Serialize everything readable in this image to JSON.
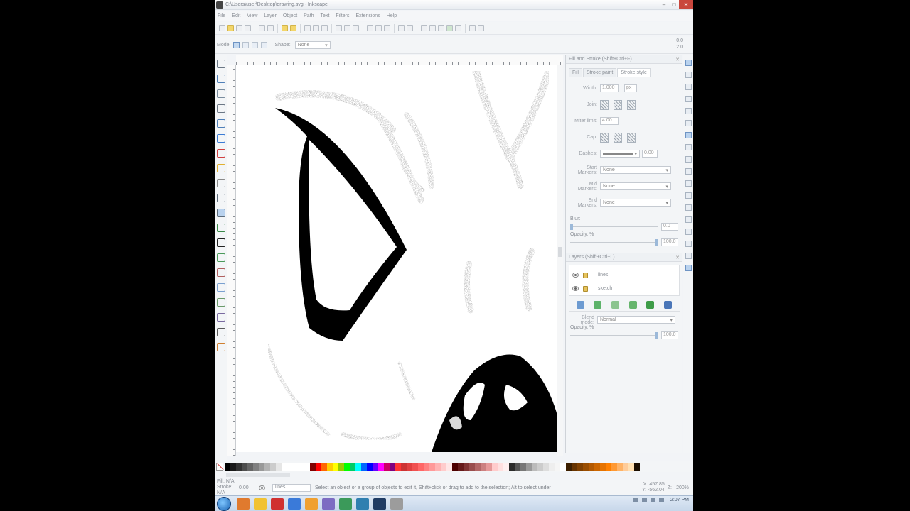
{
  "window": {
    "title": "C:\\Users\\user\\Desktop\\drawing.svg - Inkscape",
    "controls": [
      "minimize",
      "maximize",
      "close"
    ]
  },
  "menu": [
    "File",
    "Edit",
    "View",
    "Layer",
    "Object",
    "Path",
    "Text",
    "Filters",
    "Extensions",
    "Help"
  ],
  "tool_controls": {
    "mode_label": "Mode:",
    "shape_label": "Shape:",
    "shape_value": "None",
    "readout_top": "0.0",
    "readout_bottom": "2.0"
  },
  "fill_stroke": {
    "title": "Fill and Stroke (Shift+Ctrl+F)",
    "tabs": [
      "Fill",
      "Stroke paint",
      "Stroke style"
    ],
    "active_tab": 2,
    "width_label": "Width:",
    "width_value": "1.000",
    "unit_value": "px",
    "join_label": "Join:",
    "miter_label": "Miter limit:",
    "miter_value": "4.00",
    "cap_label": "Cap:",
    "dashes_label": "Dashes:",
    "dash_value": "0.00",
    "start_marker_label": "Start Markers:",
    "mid_marker_label": "Mid Markers:",
    "end_marker_label": "End Markers:",
    "marker_value": "None",
    "blur_label": "Blur:",
    "blur_value": "0.0",
    "opacity_label": "Opacity, %",
    "opacity_value": "100.0"
  },
  "layers_panel": {
    "title": "Layers (Shift+Ctrl+L)",
    "items": [
      {
        "name": "lines"
      },
      {
        "name": "sketch"
      }
    ],
    "blend_label": "Blend mode:",
    "blend_value": "Normal",
    "opacity_label": "Opacity, %",
    "opacity_value": "100.0"
  },
  "palette": {
    "swatches": [
      "#000000",
      "#1a1a1a",
      "#333333",
      "#4d4d4d",
      "#666666",
      "#808080",
      "#999999",
      "#b3b3b3",
      "#cccccc",
      "#e6e6e6",
      "#ffffff",
      "#ffffff",
      "#ffffff",
      "#ffffff",
      "#ffffff",
      "#800000",
      "#ff0000",
      "#ff6600",
      "#ffcc00",
      "#ffff00",
      "#99cc00",
      "#00ff00",
      "#00cc66",
      "#00ffff",
      "#0066ff",
      "#0000ff",
      "#6600ff",
      "#ff00ff",
      "#cc0066",
      "#800080",
      "#ff3333",
      "#cc3333",
      "#e04040",
      "#f05050",
      "#ff6666",
      "#ff8080",
      "#ff9999",
      "#ffb3b3",
      "#ffcccc",
      "#ffe6e6",
      "#4d0000",
      "#661a1a",
      "#803333",
      "#994d4d",
      "#b36666",
      "#cc8080",
      "#e69999",
      "#ffcccc",
      "#ffe0e0",
      "#fff0f0",
      "#2b2b2b",
      "#555555",
      "#777777",
      "#999999",
      "#bbbbbb",
      "#cccccc",
      "#dddddd",
      "#eeeeee",
      "#f5f5f5",
      "#ffffff",
      "#3d1f00",
      "#663300",
      "#804000",
      "#994d00",
      "#b35900",
      "#cc6600",
      "#e67300",
      "#ff8000",
      "#ff9933",
      "#ffb366",
      "#ffcc99",
      "#ffe0b3",
      "#1a0d00"
    ]
  },
  "status": {
    "fill_label": "Fill:",
    "stroke_label": "Stroke:",
    "fill_value": "N/A",
    "stroke_value": "N/A",
    "opacity_value": "0.00",
    "layer_value": "lines",
    "message": "Select an object or a group of objects to edit it, Shift+click or drag to add to the selection; Alt to select under",
    "x_label": "X:",
    "x_value": "457.85",
    "y_label": "Y:",
    "y_value": "-562.04",
    "zoom_label": "Z:",
    "zoom_value": "200%"
  },
  "taskbar": {
    "time": "2:07 PM"
  },
  "icons": {
    "tools": [
      "selector-icon",
      "node-icon",
      "tweak-icon",
      "zoom-icon",
      "rectangle-icon",
      "3dbox-icon",
      "ellipse-icon",
      "star-icon",
      "spiral-icon",
      "pencil-icon",
      "pen-icon",
      "calligraphy-icon",
      "text-icon",
      "spray-icon",
      "eraser-icon",
      "bucket-icon",
      "gradient-icon",
      "mesh-icon",
      "dropper-icon",
      "connector-icon"
    ]
  }
}
